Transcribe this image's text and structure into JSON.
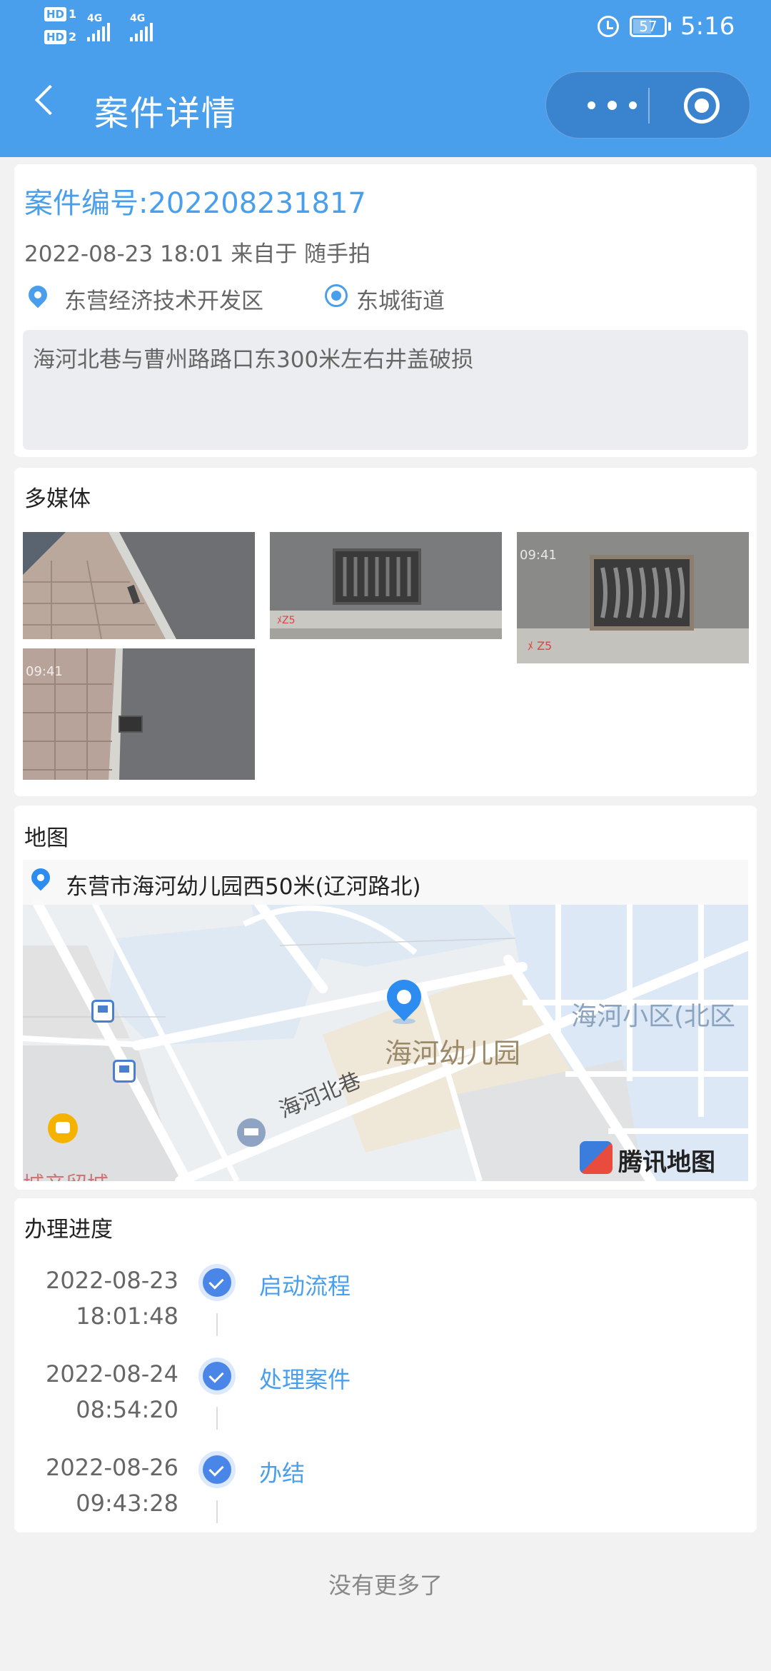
{
  "status_bar": {
    "hd1": "HD",
    "hd1_num": "1",
    "hd2": "HD",
    "hd2_num": "2",
    "net1": "4G",
    "net2": "4G",
    "battery": "57",
    "battery_level": 0.57,
    "time": "5:16"
  },
  "nav": {
    "title": "案件详情",
    "back_icon": "chevron-left-icon",
    "more_icon": "more-dots-icon",
    "close_icon": "target-close-icon"
  },
  "case": {
    "number": "案件编号:202208231817",
    "meta": "2022-08-23 18:01 来自于 随手拍",
    "district": "东营经济技术开发区",
    "street": "东城街道",
    "description": "海河北巷与曹州路路口东300米左右井盖破损"
  },
  "media": {
    "title": "多媒体",
    "thumbs": [
      {
        "name": "photo-1",
        "stamp": ""
      },
      {
        "name": "photo-2",
        "stamp": ""
      },
      {
        "name": "photo-3",
        "stamp": "09:41"
      },
      {
        "name": "photo-4",
        "stamp": "09:41"
      }
    ]
  },
  "map": {
    "title": "地图",
    "address": "东营市海河幼儿园西50米(辽河路北)",
    "labels": {
      "road": "海河北巷",
      "kindergarten": "海河幼儿园",
      "community": "海河小区(北区",
      "bottom_left": "城产留城",
      "bottom_right": "海河小区"
    },
    "provider": "腾讯地图"
  },
  "progress": {
    "title": "办理进度",
    "steps": [
      {
        "date": "2022-08-23",
        "time": "18:01:48",
        "label": "启动流程"
      },
      {
        "date": "2022-08-24",
        "time": "08:54:20",
        "label": "处理案件"
      },
      {
        "date": "2022-08-26",
        "time": "09:43:28",
        "label": "办结"
      }
    ]
  },
  "footer": {
    "no_more": "没有更多了"
  },
  "colors": {
    "primary": "#4a9fed",
    "check": "#4a86e8",
    "background": "#f2f2f2"
  }
}
